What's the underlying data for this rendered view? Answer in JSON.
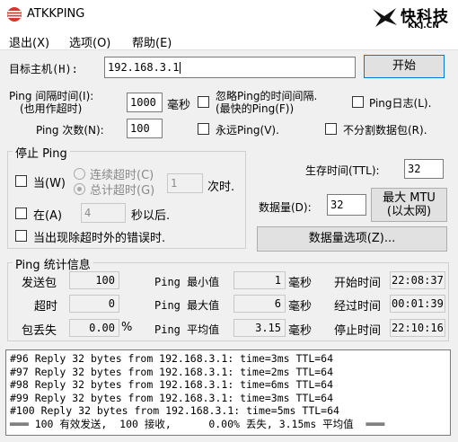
{
  "window": {
    "title": "ATKKPING",
    "brand_cn": "快科技",
    "brand_en": "KKJ.CN"
  },
  "menu": [
    "退出(X)",
    "选项(O)",
    "帮助(E)"
  ],
  "target": {
    "label": "目标主机(H):",
    "value": "192.168.3.1",
    "start_button": "开始"
  },
  "options": {
    "interval_label_1": "Ping 间隔时间(I):",
    "interval_label_2": "(也用作超时)",
    "interval_value": "1000",
    "interval_unit": "毫秒",
    "ignore_label_1": "忽略Ping的时间间隔.",
    "ignore_label_2": "(最快的Ping(F))",
    "log_label": "Ping日志(L).",
    "count_label": "Ping 次数(N):",
    "count_value": "100",
    "forever_label": "永远Ping(V).",
    "nofrag_label": "不分割数据包(R).",
    "ttl_label": "生存时间(TTL):",
    "ttl_value": "32",
    "size_label": "数据量(D):",
    "size_value": "32",
    "mtu_button_1": "最大 MTU",
    "mtu_button_2": "(以太网)",
    "data_options_button": "数据量选项(Z)..."
  },
  "stop": {
    "title": "停止 Ping",
    "when_label": "当(W)",
    "consecutive_label": "连续超时(C)",
    "total_label": "总计超时(G)",
    "timeout_value": "1",
    "times_label": "次时.",
    "at_label": "在(A)",
    "at_value": "4",
    "seconds_label": "秒以后.",
    "error_label": "当出现除超时外的错误时."
  },
  "stats": {
    "title": "Ping 统计信息",
    "sent_label": "发送包",
    "sent_value": "100",
    "timeout_label": "超时",
    "timeout_value": "0",
    "loss_label": "包丢失",
    "loss_value": "0.00",
    "loss_unit": "%",
    "min_label": "Ping 最小值",
    "min_value": "1",
    "min_unit": "毫秒",
    "max_label": "Ping 最大值",
    "max_value": "6",
    "max_unit": "毫秒",
    "avg_label": "Ping 平均值",
    "avg_value": "3.15",
    "avg_unit": "毫秒",
    "start_label": "开始时间",
    "start_value": "22:08:37",
    "elapsed_label": "经过时间",
    "elapsed_value": "00:01:39",
    "stop_label": "停止时间",
    "stop_value": "22:10:16"
  },
  "log": [
    "#96 Reply 32 bytes from 192.168.3.1: time=3ms TTL=64",
    "#97 Reply 32 bytes from 192.168.3.1: time=2ms TTL=64",
    "#98 Reply 32 bytes from 192.168.3.1: time=6ms TTL=64",
    "#99 Reply 32 bytes from 192.168.3.1: time=3ms TTL=64",
    "#100 Reply 32 bytes from 192.168.3.1: time=5ms TTL=64",
    "═══ 100 有效发送,  100 接收,      0.00% 丢失, 3.15ms 平均值  ═══"
  ]
}
